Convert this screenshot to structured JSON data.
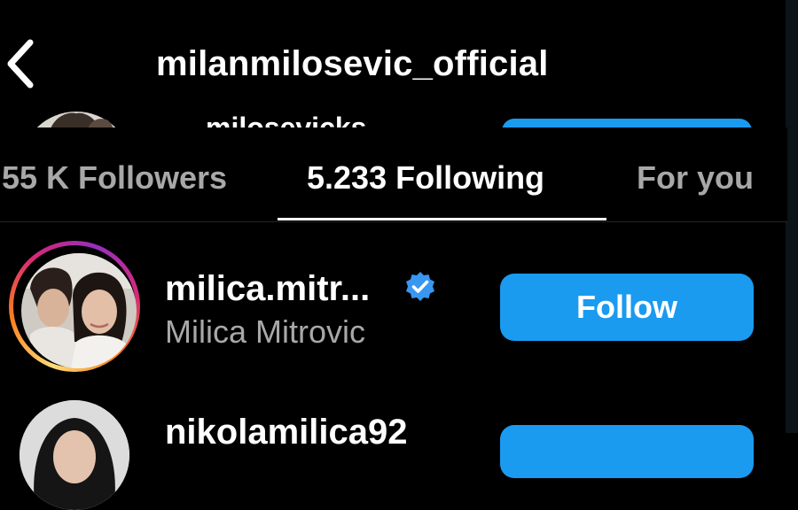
{
  "header": {
    "back_icon": "chevron-left-icon",
    "title": "milanmilosevic_official"
  },
  "partial_row": {
    "username": "milosevicks"
  },
  "tabs": [
    {
      "label": "55 K Followers",
      "active": false
    },
    {
      "label": "5.233 Following",
      "active": true
    },
    {
      "label": "For you",
      "active": false
    }
  ],
  "rows": [
    {
      "username": "milica.mitr...",
      "verified": true,
      "verified_icon": "verified-badge-icon",
      "full_name": "Milica Mitrovic",
      "button_label": "Follow",
      "has_story": true
    },
    {
      "username": "nikolamilica92"
    }
  ],
  "colors": {
    "background": "#000000",
    "primary_button": "#1a9bf0",
    "secondary_text": "#a8a8a8",
    "verified_badge": "#3897f0"
  }
}
